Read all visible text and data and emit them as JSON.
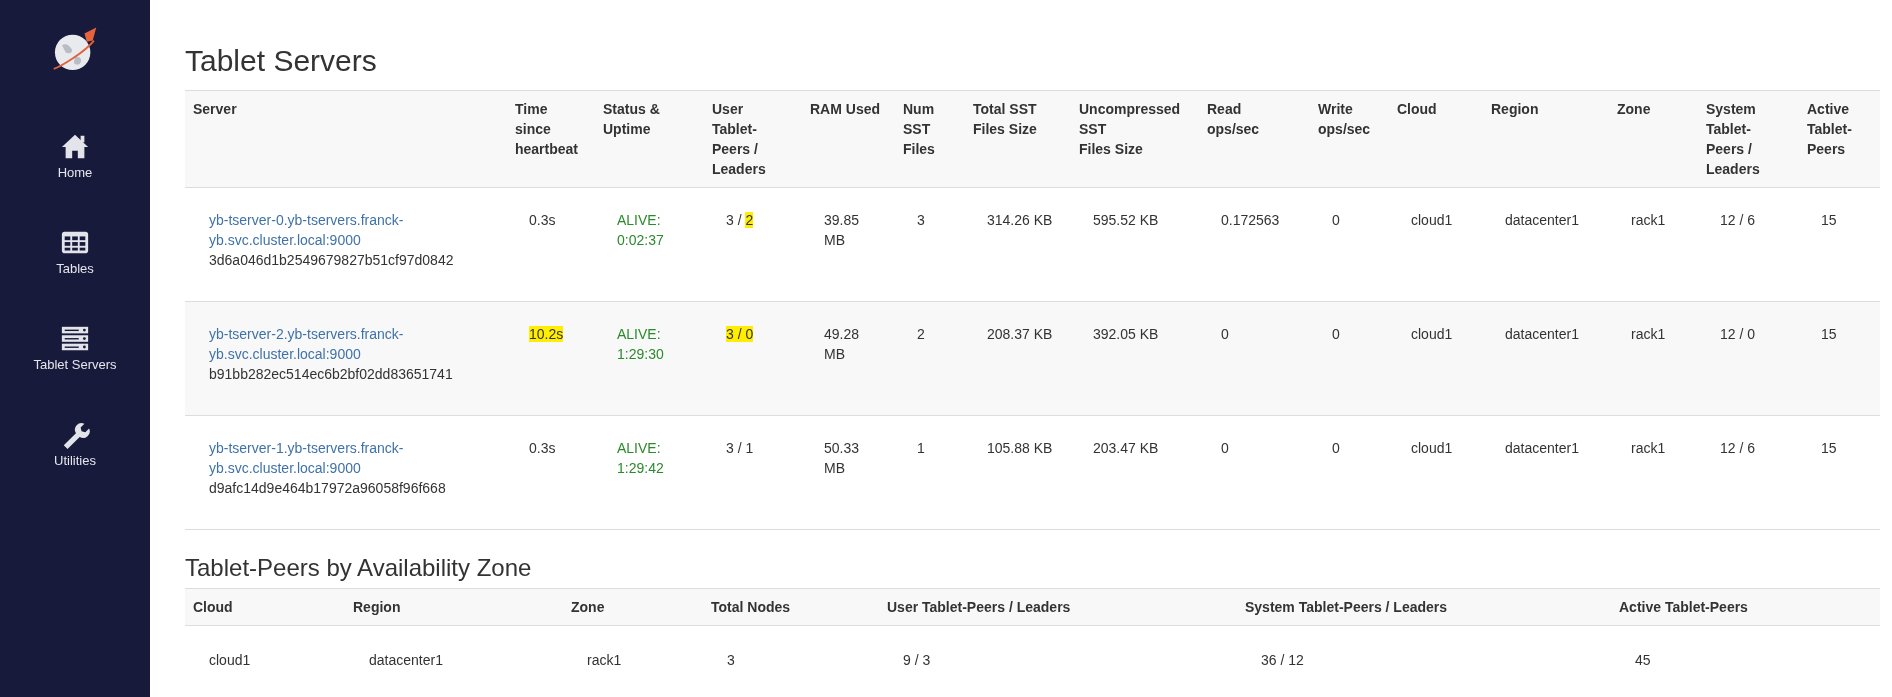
{
  "sidebar": {
    "items": [
      {
        "label": "Home",
        "kind": "home",
        "selected": false
      },
      {
        "label": "Tables",
        "kind": "table",
        "selected": false
      },
      {
        "label": "Tablet Servers",
        "kind": "servers",
        "selected": false
      },
      {
        "label": "Utilities",
        "kind": "wrench",
        "selected": false
      }
    ]
  },
  "servers": {
    "title": "Tablet Servers",
    "columns": [
      {
        "label": "Server",
        "kind": "server"
      },
      {
        "label": "Time since heartbeat",
        "kind": "plain"
      },
      {
        "label": "Status & Uptime",
        "kind": "status"
      },
      {
        "label": "User Tablet-Peers / Leaders",
        "kind": "plain"
      },
      {
        "label": "RAM Used",
        "kind": "plain"
      },
      {
        "label": "Num SST Files",
        "kind": "plain"
      },
      {
        "label": "Total SST Files Size",
        "kind": "plain"
      },
      {
        "label": "Uncompressed SST\nFiles Size",
        "kind": "plain"
      },
      {
        "label": "Read ops/sec",
        "kind": "plain"
      },
      {
        "label": "Write ops/sec",
        "kind": "plain"
      },
      {
        "label": "Cloud",
        "kind": "plain"
      },
      {
        "label": "Region",
        "kind": "plain"
      },
      {
        "label": "Zone",
        "kind": "plain"
      },
      {
        "label": "System Tablet-Peers / Leaders",
        "kind": "plain"
      },
      {
        "label": "Active Tablet-Peers",
        "kind": "plain"
      }
    ],
    "rows": [
      {
        "cells": [
          {
            "link": "yb-tserver-0.yb-tservers.franck-yb.svc.cluster.local:9000",
            "uuid": "3d6a046d1b2549679827b51cf97d0842"
          },
          {
            "parts": [
              {
                "text": "0.3s",
                "highlighted": false
              }
            ]
          },
          {
            "parts": [
              {
                "text": "ALIVE: 0:02:37",
                "highlighted": false
              }
            ]
          },
          {
            "parts": [
              {
                "text": "3 / ",
                "highlighted": false
              },
              {
                "text": "2",
                "highlighted": true
              }
            ]
          },
          {
            "parts": [
              {
                "text": "39.85 MB",
                "highlighted": false
              }
            ]
          },
          {
            "parts": [
              {
                "text": "3",
                "highlighted": false
              }
            ]
          },
          {
            "parts": [
              {
                "text": "314.26 KB",
                "highlighted": false
              }
            ]
          },
          {
            "parts": [
              {
                "text": "595.52 KB",
                "highlighted": false
              }
            ]
          },
          {
            "parts": [
              {
                "text": "0.172563",
                "highlighted": false
              }
            ]
          },
          {
            "parts": [
              {
                "text": "0",
                "highlighted": false
              }
            ]
          },
          {
            "parts": [
              {
                "text": "cloud1",
                "highlighted": false
              }
            ]
          },
          {
            "parts": [
              {
                "text": "datacenter1",
                "highlighted": false
              }
            ]
          },
          {
            "parts": [
              {
                "text": "rack1",
                "highlighted": false
              }
            ]
          },
          {
            "parts": [
              {
                "text": "12 / 6",
                "highlighted": false
              }
            ]
          },
          {
            "parts": [
              {
                "text": "15",
                "highlighted": false
              }
            ]
          }
        ]
      },
      {
        "cells": [
          {
            "link": "yb-tserver-2.yb-tservers.franck-yb.svc.cluster.local:9000",
            "uuid": "b91bb282ec514ec6b2bf02dd83651741"
          },
          {
            "parts": [
              {
                "text": "10.2s",
                "highlighted": true
              }
            ]
          },
          {
            "parts": [
              {
                "text": "ALIVE: 1:29:30",
                "highlighted": false
              }
            ]
          },
          {
            "parts": [
              {
                "text": "3 / 0",
                "highlighted": true
              }
            ]
          },
          {
            "parts": [
              {
                "text": "49.28 MB",
                "highlighted": false
              }
            ]
          },
          {
            "parts": [
              {
                "text": "2",
                "highlighted": false
              }
            ]
          },
          {
            "parts": [
              {
                "text": "208.37 KB",
                "highlighted": false
              }
            ]
          },
          {
            "parts": [
              {
                "text": "392.05 KB",
                "highlighted": false
              }
            ]
          },
          {
            "parts": [
              {
                "text": "0",
                "highlighted": false
              }
            ]
          },
          {
            "parts": [
              {
                "text": "0",
                "highlighted": false
              }
            ]
          },
          {
            "parts": [
              {
                "text": "cloud1",
                "highlighted": false
              }
            ]
          },
          {
            "parts": [
              {
                "text": "datacenter1",
                "highlighted": false
              }
            ]
          },
          {
            "parts": [
              {
                "text": "rack1",
                "highlighted": false
              }
            ]
          },
          {
            "parts": [
              {
                "text": "12 / 0",
                "highlighted": false
              }
            ]
          },
          {
            "parts": [
              {
                "text": "15",
                "highlighted": false
              }
            ]
          }
        ]
      },
      {
        "cells": [
          {
            "link": "yb-tserver-1.yb-tservers.franck-yb.svc.cluster.local:9000",
            "uuid": "d9afc14d9e464b17972a96058f96f668"
          },
          {
            "parts": [
              {
                "text": "0.3s",
                "highlighted": false
              }
            ]
          },
          {
            "parts": [
              {
                "text": "ALIVE: 1:29:42",
                "highlighted": false
              }
            ]
          },
          {
            "parts": [
              {
                "text": "3 / 1",
                "highlighted": false
              }
            ]
          },
          {
            "parts": [
              {
                "text": "50.33 MB",
                "highlighted": false
              }
            ]
          },
          {
            "parts": [
              {
                "text": "1",
                "highlighted": false
              }
            ]
          },
          {
            "parts": [
              {
                "text": "105.88 KB",
                "highlighted": false
              }
            ]
          },
          {
            "parts": [
              {
                "text": "203.47 KB",
                "highlighted": false
              }
            ]
          },
          {
            "parts": [
              {
                "text": "0",
                "highlighted": false
              }
            ]
          },
          {
            "parts": [
              {
                "text": "0",
                "highlighted": false
              }
            ]
          },
          {
            "parts": [
              {
                "text": "cloud1",
                "highlighted": false
              }
            ]
          },
          {
            "parts": [
              {
                "text": "datacenter1",
                "highlighted": false
              }
            ]
          },
          {
            "parts": [
              {
                "text": "rack1",
                "highlighted": false
              }
            ]
          },
          {
            "parts": [
              {
                "text": "12 / 6",
                "highlighted": false
              }
            ]
          },
          {
            "parts": [
              {
                "text": "15",
                "highlighted": false
              }
            ]
          }
        ]
      }
    ]
  },
  "zones": {
    "title": "Tablet-Peers by Availability Zone",
    "columns": [
      "Cloud",
      "Region",
      "Zone",
      "Total Nodes",
      "User Tablet-Peers / Leaders",
      "System Tablet-Peers / Leaders",
      "Active Tablet-Peers"
    ],
    "rows": [
      [
        "cloud1",
        "datacenter1",
        "rack1",
        "3",
        "9 / 3",
        "36 / 12",
        "45"
      ]
    ]
  }
}
